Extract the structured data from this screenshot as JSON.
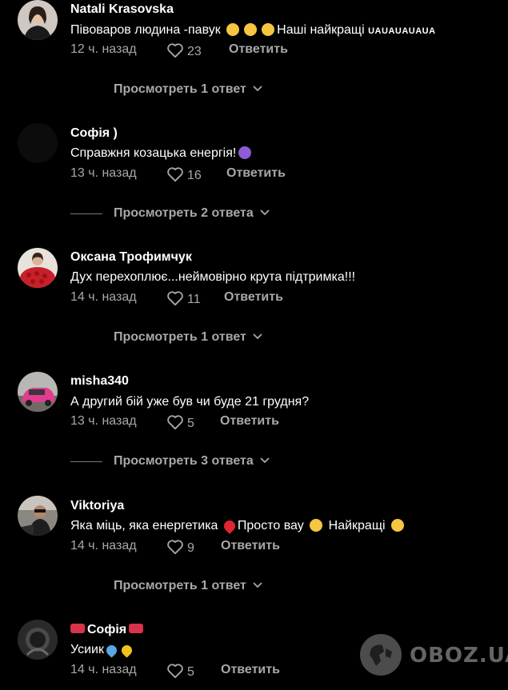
{
  "comments": [
    {
      "author": "Natali Krasovska",
      "text_main": "Пiвоваров людина -павук",
      "text_after": "Наші найкращі",
      "text_tiny": "UAUAUAUAUA",
      "emoji_names": [
        "grinning-face-icon",
        "grinning-face-icon",
        "grinning-face-icon"
      ],
      "time": "12 ч. назад",
      "likes": "23",
      "reply_label": "Ответить",
      "view_replies": "Просмотреть 1 ответ"
    },
    {
      "author": "Софія )",
      "text_main": "Справжня козацька енергія!",
      "emoji_names": [
        "smiling-devil-icon"
      ],
      "time": "13 ч. назад",
      "likes": "16",
      "reply_label": "Ответить",
      "view_replies": "Просмотреть 2 ответа"
    },
    {
      "author": "Оксана Трофимчук",
      "text_main": "Дух перехоплює...неймовірно крута підтримка!!!",
      "time": "14 ч. назад",
      "likes": "11",
      "reply_label": "Ответить",
      "view_replies": "Просмотреть 1 ответ"
    },
    {
      "author": "misha340",
      "text_main": "А другий бій уже був чи буде 21 грудня?",
      "time": "13 ч. назад",
      "likes": "5",
      "reply_label": "Ответить",
      "view_replies": "Просмотреть 3 ответа"
    },
    {
      "author": "Viktoriya",
      "text_main": "Яка міць, яка енергетика",
      "text_mid": "Просто вау",
      "text_after": "Найкращі",
      "emoji_names": [
        "red-heart-icon",
        "star-struck-icon",
        "star-struck-icon"
      ],
      "time": "14 ч. назад",
      "likes": "9",
      "reply_label": "Ответить",
      "view_replies": "Просмотреть 1 ответ"
    },
    {
      "author": "Софія",
      "text_main": "Усиик",
      "emoji_names": [
        "ribbon-icon",
        "ribbon-icon",
        "blue-heart-icon",
        "yellow-heart-icon"
      ],
      "time": "14 ч. назад",
      "likes": "5",
      "reply_label": "Ответить"
    }
  ],
  "colors": {
    "background": "#000000",
    "text": "#ffffff",
    "muted": "#a8a8a8"
  },
  "watermark": {
    "text": "OBOZ.UA"
  }
}
